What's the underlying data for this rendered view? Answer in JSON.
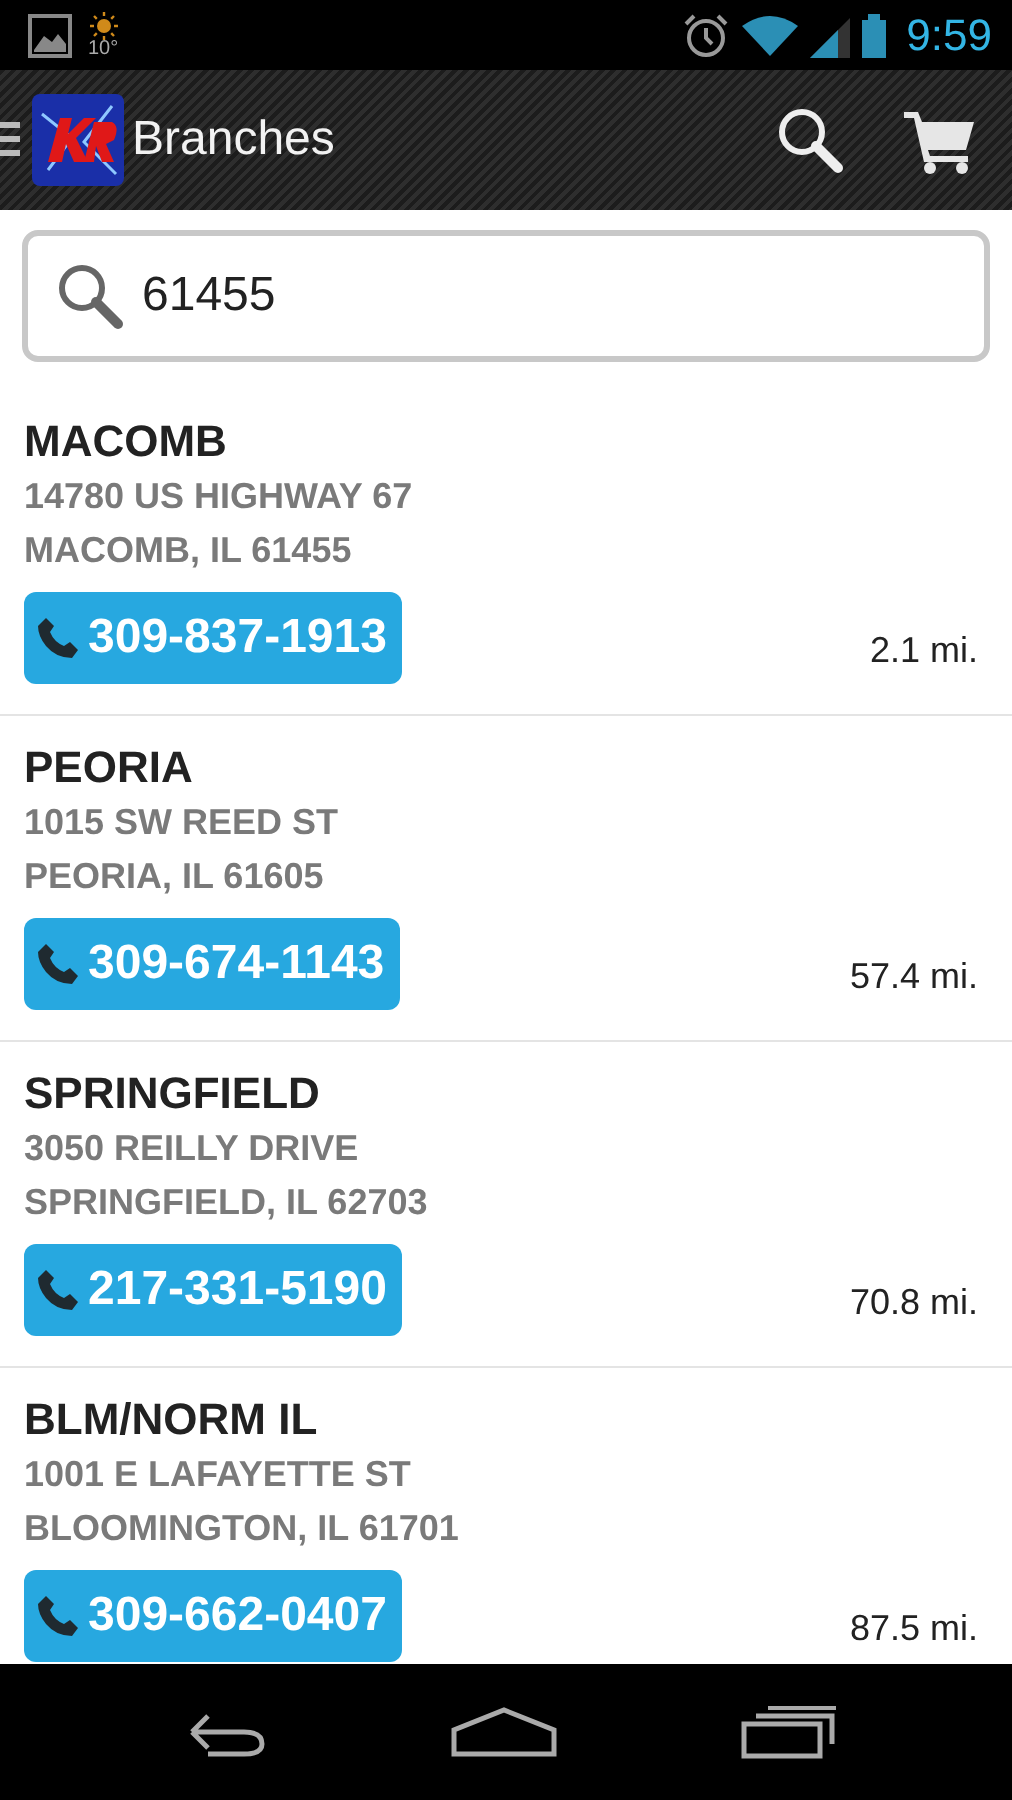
{
  "status_bar": {
    "temperature": "10°",
    "time": "9:59"
  },
  "action_bar": {
    "title": "Branches"
  },
  "search": {
    "value": "61455"
  },
  "branches": [
    {
      "name": "MACOMB",
      "address": "14780 US HIGHWAY 67",
      "city": "MACOMB, IL 61455",
      "phone": "309-837-1913",
      "distance": "2.1 mi."
    },
    {
      "name": "PEORIA",
      "address": "1015 SW REED ST",
      "city": "PEORIA, IL 61605",
      "phone": "309-674-1143",
      "distance": "57.4 mi."
    },
    {
      "name": "SPRINGFIELD",
      "address": "3050 REILLY DRIVE",
      "city": "SPRINGFIELD, IL 62703",
      "phone": "217-331-5190",
      "distance": "70.8 mi."
    },
    {
      "name": "BLM/NORM IL",
      "address": "1001 E LAFAYETTE ST",
      "city": "BLOOMINGTON, IL 61701",
      "phone": "309-662-0407",
      "distance": "87.5 mi."
    }
  ]
}
